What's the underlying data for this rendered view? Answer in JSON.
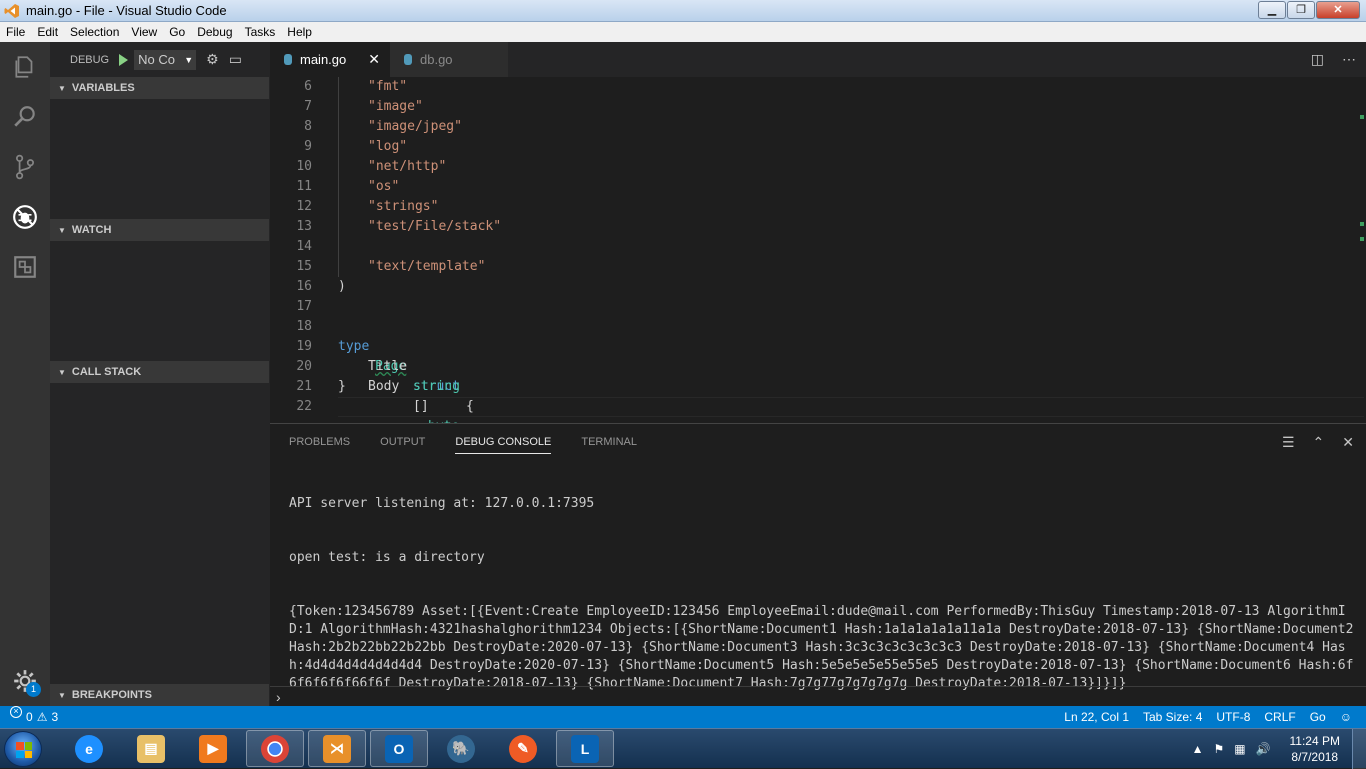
{
  "window": {
    "title": "main.go - File - Visual Studio Code",
    "min": "▁",
    "max": "❐",
    "close": "✕"
  },
  "menu": [
    "File",
    "Edit",
    "Selection",
    "View",
    "Go",
    "Debug",
    "Tasks",
    "Help"
  ],
  "activitybar": {
    "icons": [
      "files-icon",
      "search-icon",
      "source-control-icon",
      "debug-icon",
      "extensions-icon",
      "gear-icon"
    ],
    "gear_badge": "1"
  },
  "debug": {
    "label": "DEBUG",
    "config": "No Co"
  },
  "sidebar": {
    "sections": [
      "VARIABLES",
      "WATCH",
      "CALL STACK",
      "BREAKPOINTS"
    ]
  },
  "tabs": [
    {
      "label": "main.go",
      "active": true
    },
    {
      "label": "db.go",
      "active": false
    }
  ],
  "editor": {
    "lines": [
      {
        "n": "6"
      },
      {
        "n": "7"
      },
      {
        "n": "8"
      },
      {
        "n": "9"
      },
      {
        "n": "10"
      },
      {
        "n": "11"
      },
      {
        "n": "12"
      },
      {
        "n": "13"
      },
      {
        "n": "14"
      },
      {
        "n": "15"
      },
      {
        "n": "16"
      },
      {
        "n": "17"
      },
      {
        "n": "18"
      },
      {
        "n": "19"
      },
      {
        "n": "20"
      },
      {
        "n": "21"
      },
      {
        "n": "22"
      }
    ],
    "imports": [
      "\"fmt\"",
      "\"image\"",
      "\"image/jpeg\"",
      "\"log\"",
      "\"net/http\"",
      "\"os\"",
      "\"strings\"",
      "\"test/File/stack\"",
      "",
      "\"text/template\""
    ],
    "close_paren": ")",
    "type_kw": "type",
    "type_name": "Page",
    "struct_kw": "struct",
    "open_brace": "{",
    "field1_name": "Title",
    "field1_type": "string",
    "field2_name": "Body",
    "field2_prefix": "[]",
    "field2_type": "byte",
    "close_brace": "}"
  },
  "panel": {
    "tabs": [
      "PROBLEMS",
      "OUTPUT",
      "DEBUG CONSOLE",
      "TERMINAL"
    ],
    "active_tab": "DEBUG CONSOLE",
    "console_lines": [
      "API server listening at: 127.0.0.1:7395",
      "open test: is a directory",
      "{Token:123456789 Asset:[{Event:Create EmployeeID:123456 EmployeeEmail:dude@mail.com PerformedBy:ThisGuy Timestamp:2018-07-13 AlgorithmID:1 AlgorithmHash:4321hashalghorithm1234 Objects:[{ShortName:Document1 Hash:1a1a1a1a1a11a1a DestroyDate:2018-07-13} {ShortName:Document2 Hash:2b2b22bb22b22bb DestroyDate:2020-07-13} {ShortName:Document3 Hash:3c3c3c3c3c3c3c3 DestroyDate:2018-07-13} {ShortName:Document4 Hash:4d4d4d4d4d4d4d4 DestroyDate:2020-07-13} {ShortName:Document5 Hash:5e5e5e5e55e55e5 DestroyDate:2018-07-13} {ShortName:Document6 Hash:6f6f6f6f6f66f6f DestroyDate:2018-07-13} {ShortName:Document7 Hash:7g7g77g7g7g7g7g DestroyDate:2018-07-13}]}]}"
    ],
    "repl_prompt": "›"
  },
  "statusbar": {
    "errors": "0",
    "warnings": "3",
    "position": "Ln 22, Col 1",
    "tab_size": "Tab Size: 4",
    "encoding": "UTF-8",
    "eol": "CRLF",
    "language": "Go"
  },
  "taskbar": {
    "apps": [
      "internet-explorer",
      "file-explorer",
      "media-player",
      "chrome",
      "visual-studio-code",
      "outlook",
      "postgresql",
      "postman",
      "lync"
    ],
    "clock_time": "11:24 PM",
    "clock_date": "8/7/2018"
  }
}
